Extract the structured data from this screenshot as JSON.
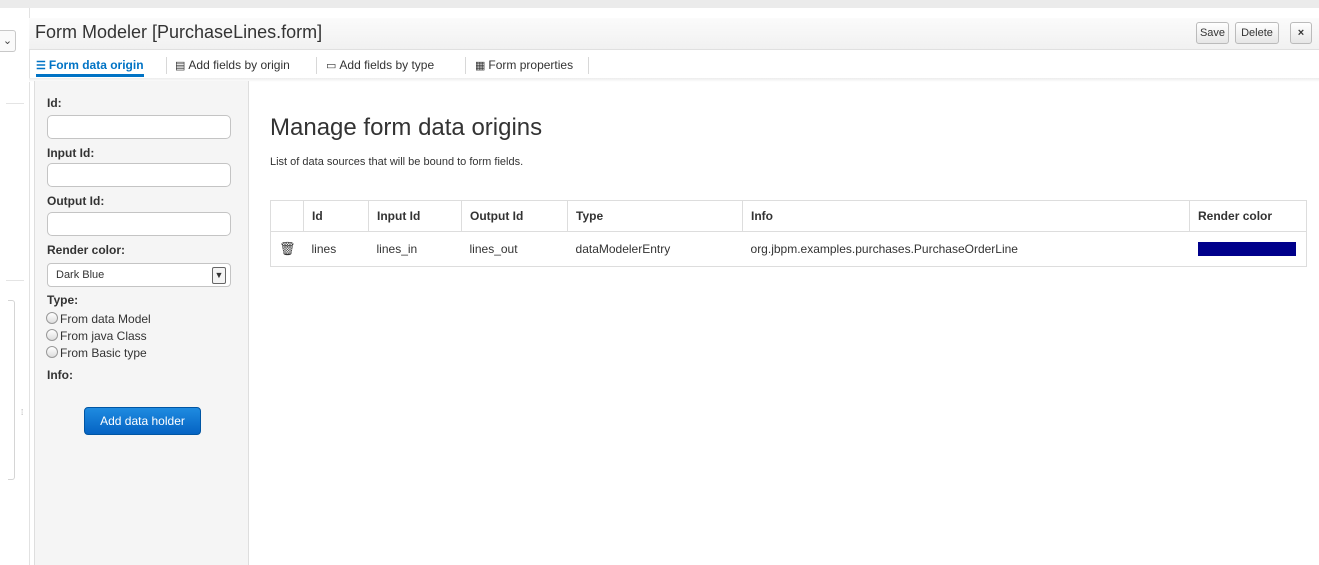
{
  "window": {
    "title": "Form Modeler [PurchaseLines.form]"
  },
  "header_buttons": {
    "save": "Save",
    "delete": "Delete",
    "close": "×"
  },
  "tabs": [
    {
      "label": "Form data origin",
      "icon": "database-icon",
      "active": true
    },
    {
      "label": "Add fields by origin",
      "icon": "add-origin-icon",
      "active": false
    },
    {
      "label": "Add fields by type",
      "icon": "add-type-icon",
      "active": false
    },
    {
      "label": "Form properties",
      "icon": "properties-icon",
      "active": false
    }
  ],
  "form": {
    "id_label": "Id:",
    "id_value": "",
    "input_id_label": "Input Id:",
    "input_id_value": "",
    "output_id_label": "Output Id:",
    "output_id_value": "",
    "render_color_label": "Render color:",
    "render_color_value": "Dark Blue",
    "type_label": "Type:",
    "type_options": [
      "From data Model",
      "From java Class",
      "From Basic type"
    ],
    "info_label": "Info:",
    "add_button": "Add data holder"
  },
  "main": {
    "heading": "Manage form data origins",
    "description": "List of data sources that will be bound to form fields.",
    "columns": [
      "",
      "Id",
      "Input Id",
      "Output Id",
      "Type",
      "Info",
      "Render color"
    ],
    "rows": [
      {
        "id": "lines",
        "input_id": "lines_in",
        "output_id": "lines_out",
        "type": "dataModelerEntry",
        "info": "org.jbpm.examples.purchases.PurchaseOrderLine",
        "render_color": "#00008b"
      }
    ]
  },
  "colors": {
    "accent": "#0073c5",
    "button": "#0a6fd0"
  }
}
